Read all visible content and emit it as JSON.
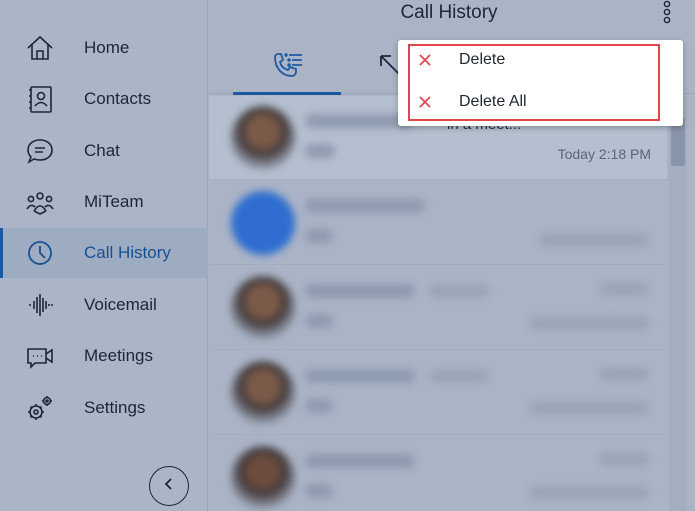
{
  "sidebar": {
    "items": [
      {
        "label": "Home",
        "icon": "home-icon"
      },
      {
        "label": "Contacts",
        "icon": "contacts-icon"
      },
      {
        "label": "Chat",
        "icon": "chat-icon"
      },
      {
        "label": "MiTeam",
        "icon": "team-icon"
      },
      {
        "label": "Call History",
        "icon": "clock-icon",
        "active": true
      },
      {
        "label": "Voicemail",
        "icon": "voicemail-icon"
      },
      {
        "label": "Meetings",
        "icon": "video-icon"
      },
      {
        "label": "Settings",
        "icon": "gear-icon"
      }
    ],
    "collapse_icon": "chevron-left-icon"
  },
  "header": {
    "title": "Call History"
  },
  "menu": {
    "items": [
      {
        "label": "Delete",
        "icon": "close-icon"
      },
      {
        "label": "Delete All",
        "icon": "close-icon"
      }
    ]
  },
  "list": {
    "rows": [
      {
        "snippet": "in a meet...",
        "time": "Today 2:18 PM"
      }
    ]
  },
  "colors": {
    "accent": "#1c5a9f",
    "menu_highlight": "#e0474c",
    "delete_icon": "#e0474c"
  }
}
